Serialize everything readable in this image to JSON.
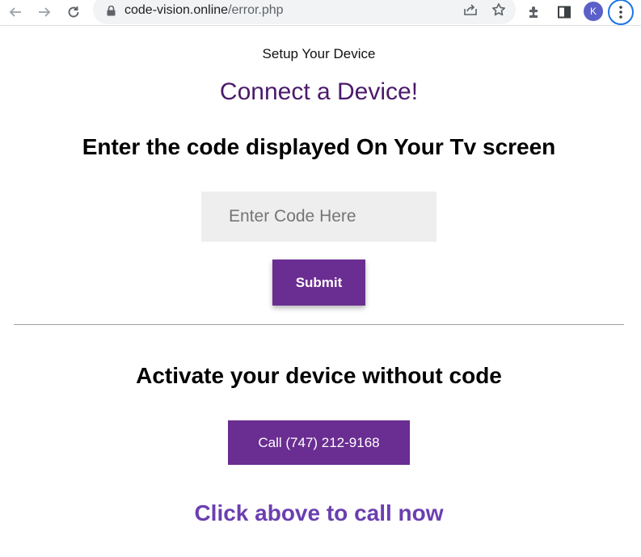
{
  "browser": {
    "url_domain": "code-vision.online",
    "url_path": "/error.php",
    "profile_initial": "K",
    "icons": [
      "back-arrow-icon",
      "forward-arrow-icon",
      "reload-icon",
      "lock-icon",
      "share-icon",
      "star-icon",
      "extensions-icon",
      "side-panel-icon",
      "more-vert-icon"
    ]
  },
  "page": {
    "setup_label": "Setup Your Device",
    "connect_heading": "Connect a Device!",
    "enter_code_heading": "Enter the code displayed On Your Tv screen",
    "code_input": {
      "placeholder": "Enter Code Here",
      "value": ""
    },
    "submit_label": "Submit",
    "activate_heading": "Activate your device without code",
    "call_label": "Call (747) 212-9168",
    "click_above_text": "Click above to call now"
  },
  "colors": {
    "accent_purple": "#6a2d91",
    "connect_heading": "#4b1a6b",
    "click_above": "#6b3fb0",
    "input_bg": "#eeeeee"
  }
}
